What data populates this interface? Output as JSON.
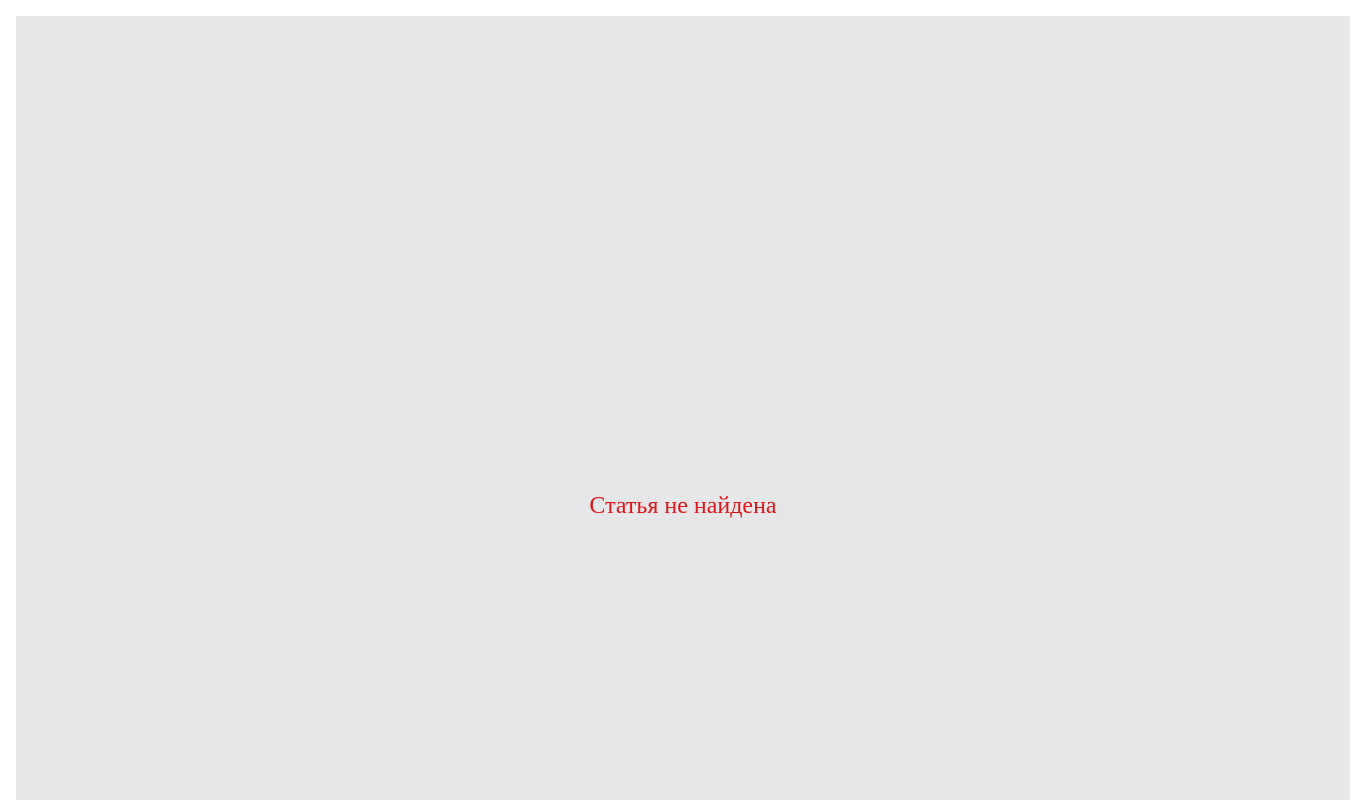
{
  "message": {
    "text": "Статья не найдена",
    "color": "#e0161a"
  },
  "panel": {
    "background": "#e7e7e9"
  }
}
